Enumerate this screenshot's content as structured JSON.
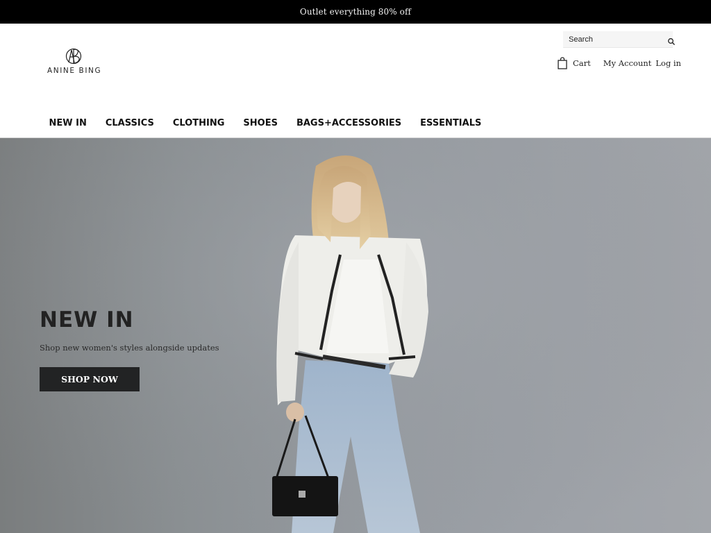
{
  "announcement": {
    "text": "Outlet everything 80% off"
  },
  "brand": {
    "name": "ANINE BING",
    "monogram": "AB"
  },
  "header": {
    "search": {
      "placeholder": "Search",
      "value": "",
      "icon": "search-icon"
    },
    "cart": {
      "label": "Cart",
      "icon": "shopping-bag-icon"
    },
    "account_label": "My Account",
    "login_label": "Log in"
  },
  "nav": {
    "items": [
      {
        "label": "NEW IN"
      },
      {
        "label": "CLASSICS"
      },
      {
        "label": "CLOTHING"
      },
      {
        "label": "SHOES"
      },
      {
        "label": "BAGS+ACCESSORIES"
      },
      {
        "label": "ESSENTIALS"
      }
    ]
  },
  "hero": {
    "title": "NEW IN",
    "subtitle": "Shop new women's styles alongside updates",
    "cta_label": "SHOP NOW",
    "image_description": "Model in white cropped jacket with black trim, light-wash jeans, holding black shoulder bag against grey backdrop"
  },
  "colors": {
    "announcement_bg": "#000000",
    "cta_bg": "#222324",
    "hero_bg": "#979ca2"
  }
}
